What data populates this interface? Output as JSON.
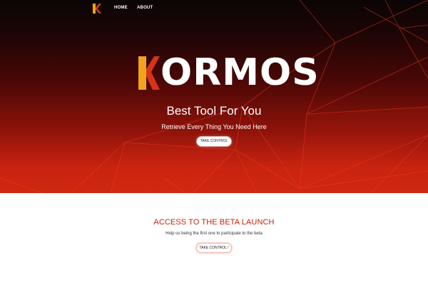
{
  "nav": {
    "logo_icon": "kormos-k-logo-icon",
    "links": [
      {
        "label": "HOME"
      },
      {
        "label": "ABOUT"
      }
    ]
  },
  "hero": {
    "brand_letter": "K",
    "brand_rest": "ORMOS",
    "tagline": "Best Tool For You",
    "subline": "Retrieve Every Thing You Need Here",
    "button_label": "TAKE CONTROL"
  },
  "beta": {
    "title": "ACCESS TO THE BETA LAUNCH",
    "subtitle": "Help us being the first one to participate to the beta",
    "button_label": "TAKE CONTROL !"
  },
  "colors": {
    "accent_red": "#c0240e",
    "logo_orange": "#f2a31b",
    "logo_red": "#e23a17",
    "hero_dark": "#0b0505"
  }
}
